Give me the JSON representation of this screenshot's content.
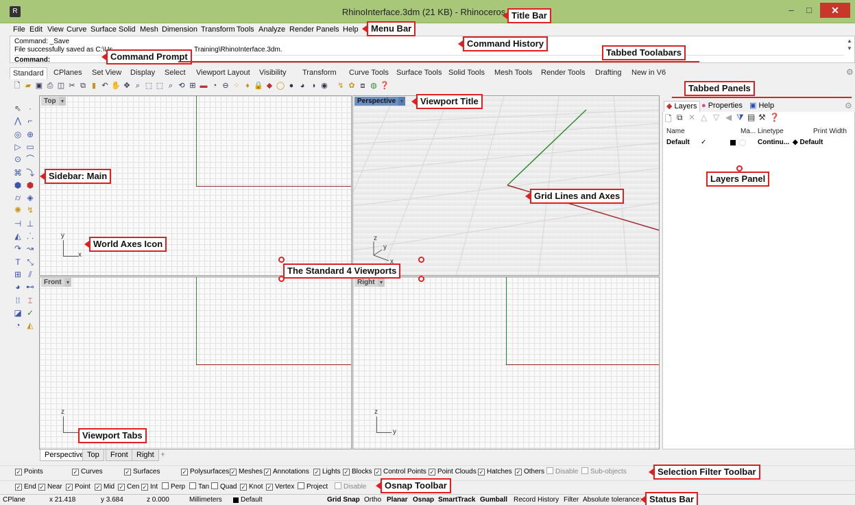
{
  "window": {
    "title": "RhinoInterface.3dm (21 KB) - Rhinoceros 6",
    "min": "–",
    "max": "□",
    "close": "✕"
  },
  "menu": [
    "File",
    "Edit",
    "View",
    "Curve",
    "Surface",
    "Solid",
    "Mesh",
    "Dimension",
    "Transform",
    "Tools",
    "Analyze",
    "Render",
    "Panels",
    "Help"
  ],
  "command": {
    "history1": "Command: _Save",
    "history2a": "File successfully saved as C:\\Us",
    "history2b": "Training\\RhinoInterface.3dm.",
    "prompt": "Command:"
  },
  "toolbar_tabs": [
    "Standard",
    "CPlanes",
    "Set View",
    "Display",
    "Select",
    "Viewport Layout",
    "Visibility",
    "Transform",
    "Curve Tools",
    "Surface Tools",
    "Solid Tools",
    "Mesh Tools",
    "Render Tools",
    "Drafting",
    "New in V6"
  ],
  "viewports": {
    "top": "Top",
    "perspective": "Perspective",
    "front": "Front",
    "right": "Right"
  },
  "axes": {
    "x": "x",
    "y": "y",
    "z": "z"
  },
  "viewport_tabs": [
    "Perspective",
    "Top",
    "Front",
    "Right"
  ],
  "panel_tabs": [
    "Layers",
    "Properties",
    "Help"
  ],
  "layers": {
    "headers": {
      "name": "Name",
      "material": "Ma...",
      "linetype": "Linetype",
      "print_width": "Print Width"
    },
    "row": {
      "name": "Default",
      "check": "✓",
      "linetype": "Continu...",
      "print_width": "◆ Default"
    }
  },
  "selection_filter": [
    {
      "label": "Points",
      "checked": true
    },
    {
      "label": "Curves",
      "checked": true
    },
    {
      "label": "Surfaces",
      "checked": true
    },
    {
      "label": "Polysurfaces",
      "checked": true
    },
    {
      "label": "Meshes",
      "checked": true
    },
    {
      "label": "Annotations",
      "checked": true
    },
    {
      "label": "Lights",
      "checked": true
    },
    {
      "label": "Blocks",
      "checked": true
    },
    {
      "label": "Control Points",
      "checked": true
    },
    {
      "label": "Point Clouds",
      "checked": true
    },
    {
      "label": "Hatches",
      "checked": true
    },
    {
      "label": "Others",
      "checked": true
    },
    {
      "label": "Disable",
      "checked": false
    },
    {
      "label": "Sub-objects",
      "checked": false
    }
  ],
  "osnap": [
    {
      "label": "End",
      "checked": true
    },
    {
      "label": "Near",
      "checked": true
    },
    {
      "label": "Point",
      "checked": true
    },
    {
      "label": "Mid",
      "checked": true
    },
    {
      "label": "Cen",
      "checked": true
    },
    {
      "label": "Int",
      "checked": true
    },
    {
      "label": "Perp",
      "checked": false
    },
    {
      "label": "Tan",
      "checked": false
    },
    {
      "label": "Quad",
      "checked": false
    },
    {
      "label": "Knot",
      "checked": true
    },
    {
      "label": "Vertex",
      "checked": true
    },
    {
      "label": "Project",
      "checked": false
    },
    {
      "label": "Disable",
      "checked": false
    }
  ],
  "status": {
    "cplane": "CPlane",
    "x": "x 21.418",
    "y": "y 3.684",
    "z": "z 0.000",
    "units": "Millimeters",
    "layer": "Default",
    "grid_snap": "Grid Snap",
    "ortho": "Ortho",
    "planar": "Planar",
    "osnap": "Osnap",
    "smarttrack": "SmartTrack",
    "gumball": "Gumball",
    "record_history": "Record History",
    "filter": "Filter",
    "tolerance": "Absolute tolerance:"
  },
  "callouts": {
    "title_bar": "Title Bar",
    "menu_bar": "Menu Bar",
    "command_prompt": "Command Prompt",
    "command_history": "Command History",
    "tabbed_toolbars": "Tabbed Toolabars",
    "tabbed_panels": "Tabbed Panels",
    "viewport_title": "Viewport Title",
    "sidebar_main": "Sidebar: Main",
    "layers_panel": "Layers Panel",
    "grid_lines": "Grid Lines and Axes",
    "world_axes": "World Axes Icon",
    "four_viewports": "The Standard 4 Viewports",
    "viewport_tabs": "Viewport Tabs",
    "selection_filter": "Selection Filter Toolbar",
    "osnap_toolbar": "Osnap Toolbar",
    "status_bar": "Status Bar"
  },
  "colors": {
    "title_bar": "#a9c779",
    "close": "#c7372a",
    "x_axis": "#9c2b2b",
    "y_axis": "#2f8a2f",
    "callout": "#e02020",
    "selected_viewport": "#6d8fc2"
  }
}
